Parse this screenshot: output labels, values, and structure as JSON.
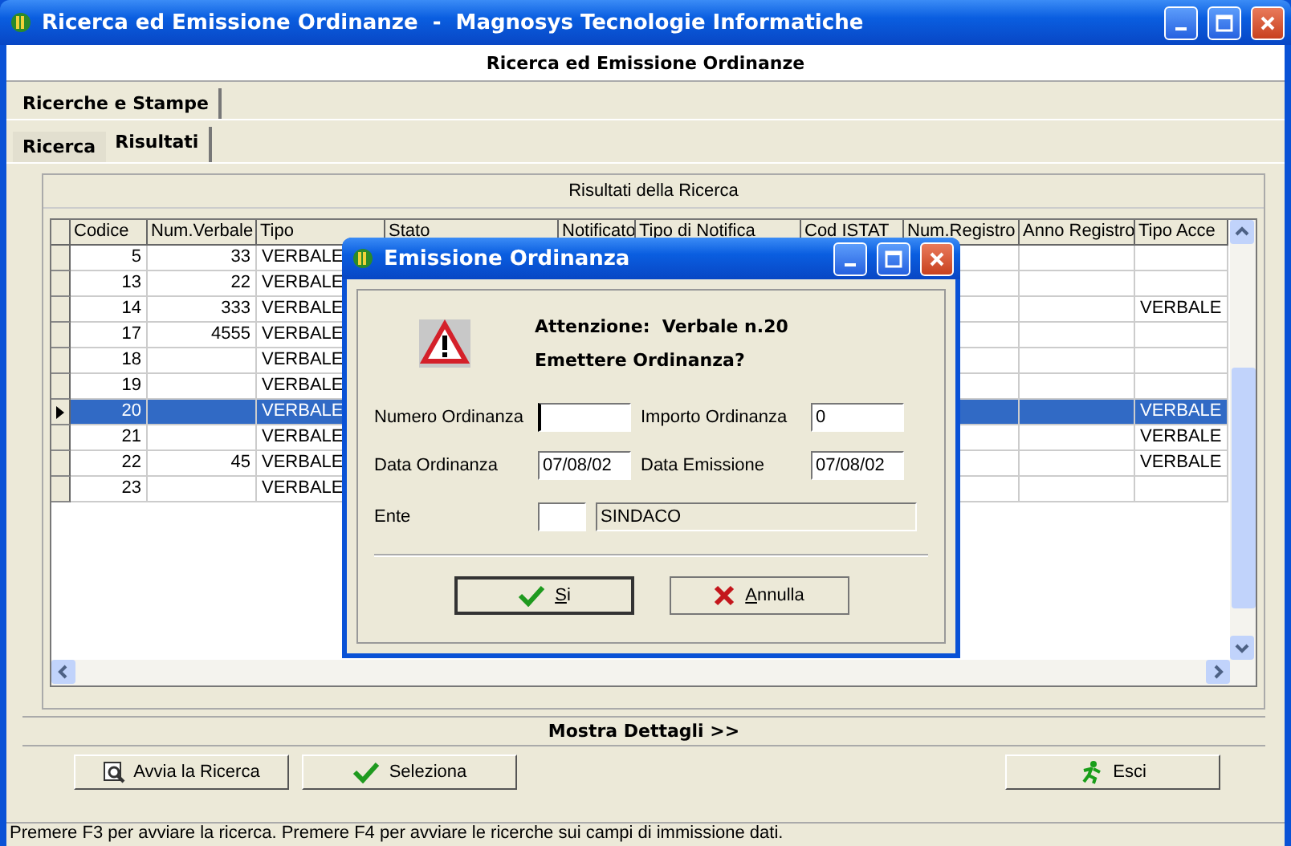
{
  "window": {
    "title": "Ricerca ed Emissione Ordinanze  -  Magnosys Tecnologie Informatiche"
  },
  "header": "Ricerca ed Emissione Ordinanze",
  "outer_tabs": [
    {
      "label": "Ricerche e Stampe",
      "selected": true
    }
  ],
  "tabs": [
    {
      "label": "Ricerca",
      "selected": false
    },
    {
      "label": "Risultati",
      "selected": true
    }
  ],
  "panel_title": "Risultati della Ricerca",
  "table": {
    "columns": [
      "Codice",
      "Num.Verbale",
      "Tipo",
      "Stato",
      "Notificato",
      "Tipo di Notifica",
      "Cod ISTAT",
      "Num.Registro",
      "Anno Registro",
      "Tipo Acce"
    ],
    "rows": [
      {
        "codice": "5",
        "num_verbale": "33",
        "tipo": "VERBALE",
        "selected": false
      },
      {
        "codice": "13",
        "num_verbale": "22",
        "tipo": "VERBALE",
        "selected": false
      },
      {
        "codice": "14",
        "num_verbale": "333",
        "tipo": "VERBALE",
        "tipo_acce": "VERBALE",
        "selected": false
      },
      {
        "codice": "17",
        "num_verbale": "4555",
        "tipo": "VERBALE",
        "selected": false
      },
      {
        "codice": "18",
        "tipo": "VERBALE",
        "selected": false
      },
      {
        "codice": "19",
        "tipo": "VERBALE",
        "selected": false
      },
      {
        "codice": "20",
        "tipo": "VERBALE",
        "tipo_acce": "VERBALE",
        "selected": true
      },
      {
        "codice": "21",
        "tipo": "VERBALE",
        "tipo_acce": "VERBALE",
        "selected": false
      },
      {
        "codice": "22",
        "num_verbale": "45",
        "tipo": "VERBALE",
        "tipo_acce": "VERBALE",
        "selected": false
      },
      {
        "codice": "23",
        "tipo": "VERBALE",
        "selected": false
      }
    ]
  },
  "details_toggle": "Mostra Dettagli >>",
  "buttons": [
    {
      "label": "Avvia la Ricerca"
    },
    {
      "label": "Seleziona"
    },
    {
      "label": "Esci"
    }
  ],
  "dialog": {
    "title": "Emissione Ordinanza",
    "message": [
      "Attenzione:  Verbale n.20",
      "Emettere Ordinanza?"
    ],
    "fields": [
      {
        "label": "Numero Ordinanza",
        "focused": true
      },
      {
        "label": "Importo Ordinanza",
        "value": "0",
        "focused": false
      },
      {
        "label": "Data Ordinanza",
        "value": "07/08/02",
        "focused": false
      },
      {
        "label": "Data Emissione",
        "value": "07/08/02",
        "focused": false
      }
    ],
    "ente": {
      "label": "Ente",
      "name": "SINDACO",
      "disabled": true
    },
    "buttons": [
      {
        "label": "Si",
        "default": true
      },
      {
        "label": "Annulla",
        "default": false
      }
    ]
  },
  "status_bar": "Premere F3 per avviare la ricerca. Premere F4 per avviare le ricerche sui campi di immissione dati."
}
